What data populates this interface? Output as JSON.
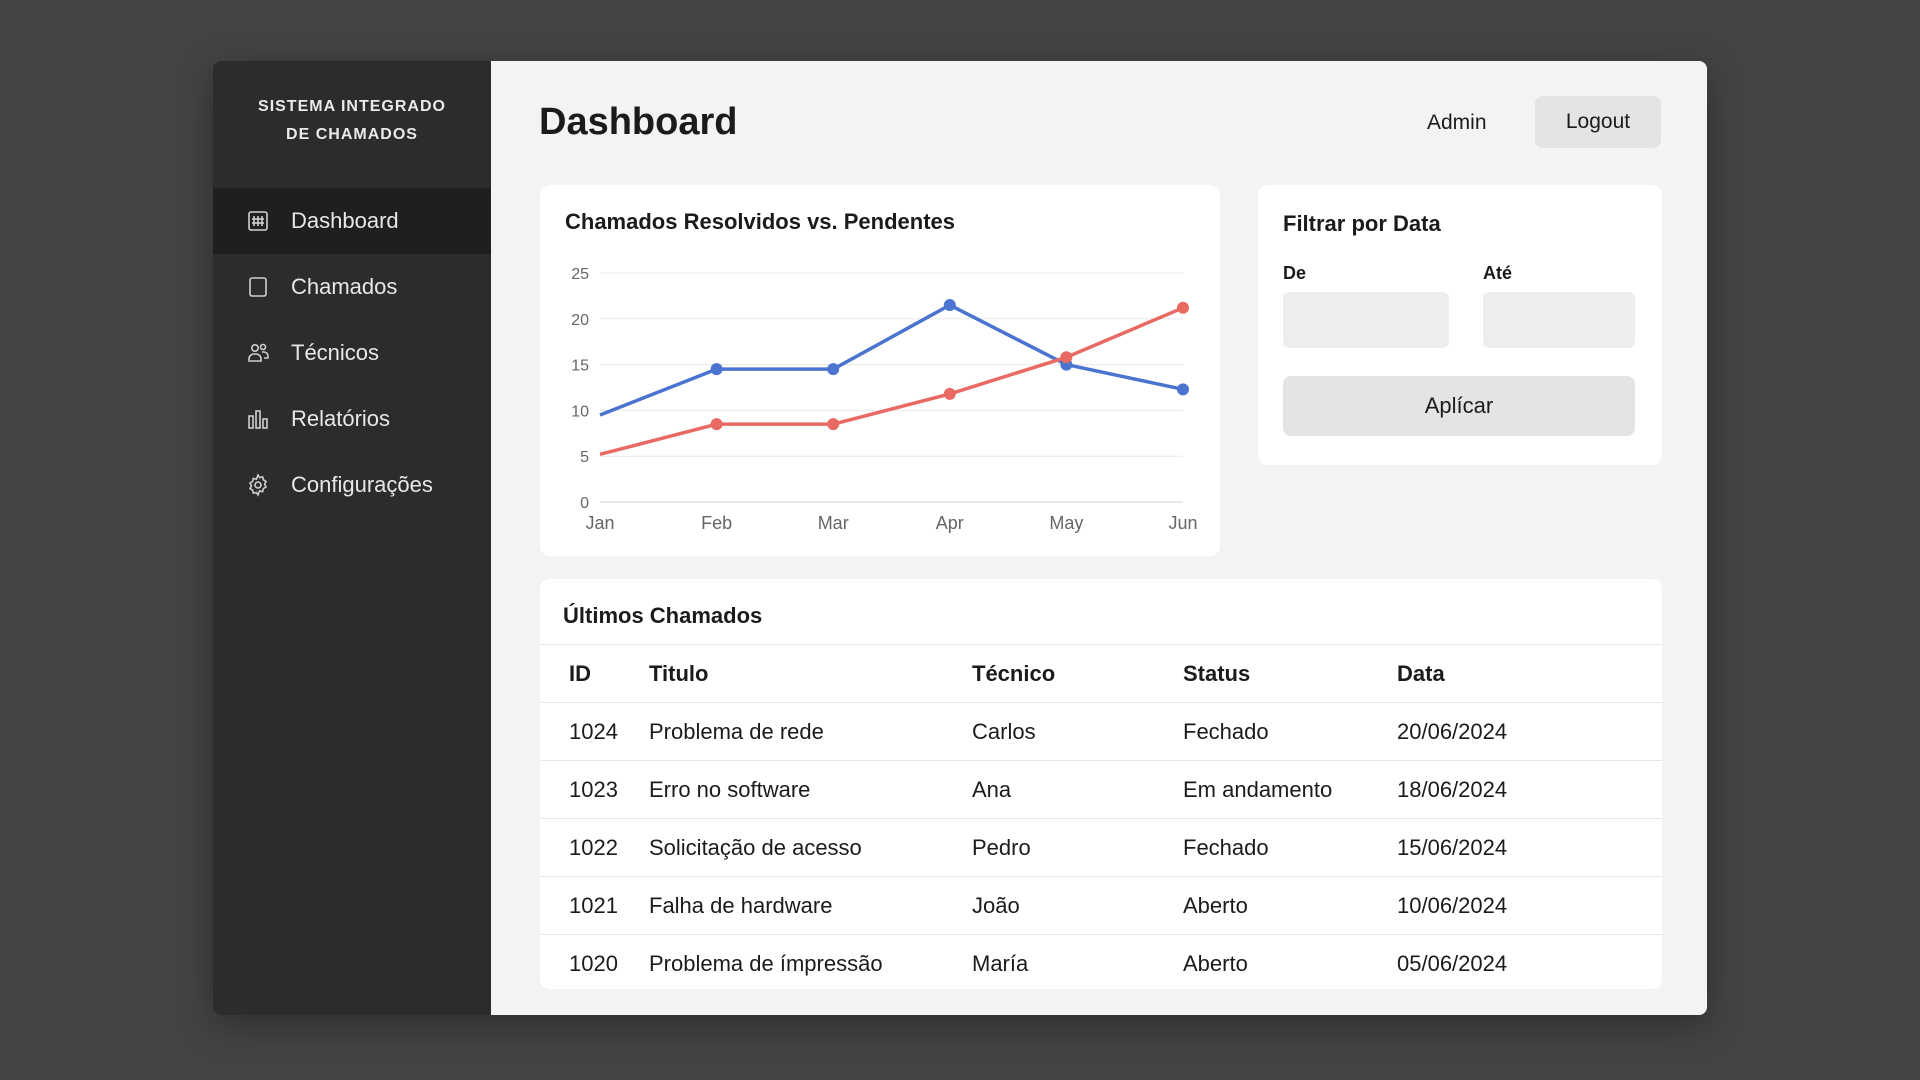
{
  "sidebar": {
    "brand": "SISTEMA INTEGRADO\nDE CHAMADOS",
    "items": [
      {
        "label": "Dashboard",
        "icon": "dashboard-icon",
        "active": true
      },
      {
        "label": "Chamados",
        "icon": "document-icon",
        "active": false
      },
      {
        "label": "Técnicos",
        "icon": "users-icon",
        "active": false
      },
      {
        "label": "Relatórios",
        "icon": "bar-chart-icon",
        "active": false
      },
      {
        "label": "Configurações",
        "icon": "gear-icon",
        "active": false
      }
    ]
  },
  "header": {
    "title": "Dashboard",
    "user": "Admin",
    "logout_label": "Logout"
  },
  "chart": {
    "title": "Chamados Resolvidos vs. Pendentes"
  },
  "chart_data": {
    "type": "line",
    "categories": [
      "Jan",
      "Feb",
      "Mar",
      "Apr",
      "May",
      "Jun"
    ],
    "series": [
      {
        "color": "#4a74d0",
        "values": [
          9.5,
          14.5,
          14.5,
          21.5,
          15,
          12.3
        ]
      },
      {
        "color": "#e86a62",
        "values": [
          5.2,
          8.5,
          8.5,
          11.8,
          15.8,
          21.2
        ]
      }
    ],
    "yticks": [
      0,
      5,
      10,
      15,
      20,
      25
    ],
    "ylim": [
      0,
      25
    ],
    "grid": true
  },
  "filter": {
    "title": "Filtrar por Data",
    "from_label": "De",
    "to_label": "Até",
    "from_value": "",
    "to_value": "",
    "apply_label": "Aplícar"
  },
  "table": {
    "title": "Últimos Chamados",
    "columns": [
      "ID",
      "Titulo",
      "Técnico",
      "Status",
      "Data"
    ],
    "rows": [
      [
        "1024",
        "Problema de rede",
        "Carlos",
        "Fechado",
        "20/06/2024"
      ],
      [
        "1023",
        "Erro no software",
        "Ana",
        "Em andamento",
        "18/06/2024"
      ],
      [
        "1022",
        "Solicitação de acesso",
        "Pedro",
        "Fechado",
        "15/06/2024"
      ],
      [
        "1021",
        "Falha de hardware",
        "João",
        "Aberto",
        "10/06/2024"
      ],
      [
        "1020",
        "Problema de ímpressão",
        "María",
        "Aberto",
        "05/06/2024"
      ]
    ]
  }
}
